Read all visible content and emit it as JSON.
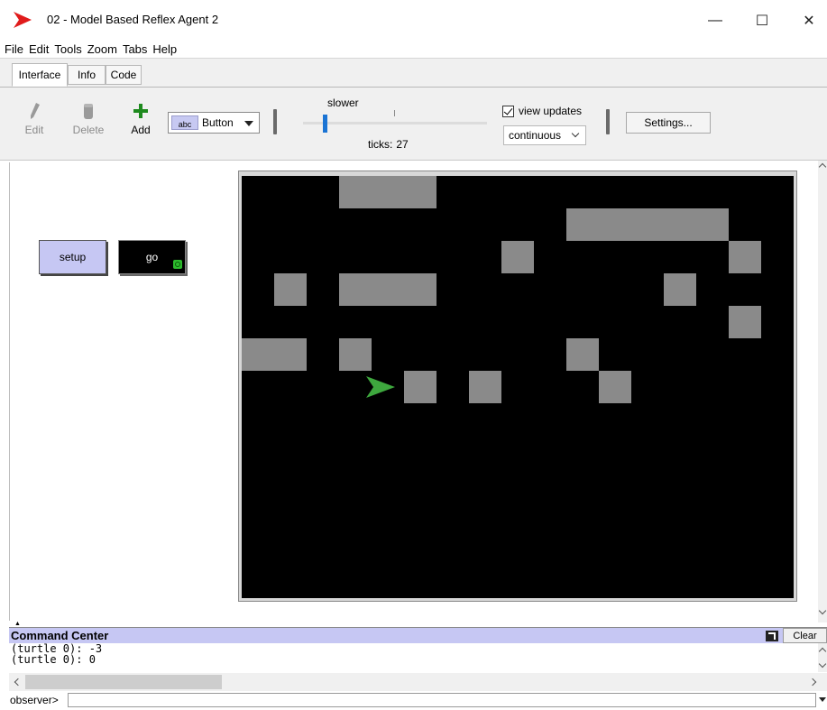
{
  "window": {
    "title": "02 - Model Based Reflex Agent 2",
    "minimize_glyph": "—",
    "maximize_glyph": "☐",
    "close_glyph": "✕"
  },
  "menu": [
    "File",
    "Edit",
    "Tools",
    "Zoom",
    "Tabs",
    "Help"
  ],
  "tabs": [
    {
      "label": "Interface",
      "active": true
    },
    {
      "label": "Info",
      "active": false
    },
    {
      "label": "Code",
      "active": false
    }
  ],
  "toolbar": {
    "edit_label": "Edit",
    "delete_label": "Delete",
    "add_label": "Add",
    "widget_type": "Button",
    "widget_icon_text": "abc",
    "speed_label": "slower",
    "ticks_label": "ticks:",
    "ticks_value": "27",
    "view_updates_label": "view updates",
    "view_updates_checked": true,
    "update_mode": "continuous",
    "settings_label": "Settings..."
  },
  "widgets": {
    "setup_label": "setup",
    "go_label": "go"
  },
  "world": {
    "background": "#000000",
    "patch_color": "#8a8a8a",
    "turtle_color": "#3ea83e",
    "columns": 17,
    "rows": 13,
    "gray_patches": [
      [
        3,
        0
      ],
      [
        4,
        0
      ],
      [
        5,
        0
      ],
      [
        10,
        1
      ],
      [
        11,
        1
      ],
      [
        12,
        1
      ],
      [
        13,
        1
      ],
      [
        14,
        1
      ],
      [
        8,
        2
      ],
      [
        15,
        2
      ],
      [
        1,
        3
      ],
      [
        3,
        3
      ],
      [
        4,
        3
      ],
      [
        5,
        3
      ],
      [
        13,
        3
      ],
      [
        15,
        4
      ],
      [
        0,
        5
      ],
      [
        1,
        5
      ],
      [
        3,
        5
      ],
      [
        10,
        5
      ],
      [
        5,
        6
      ],
      [
        7,
        6
      ],
      [
        11,
        6
      ]
    ],
    "turtle_cell": [
      4,
      6
    ]
  },
  "command_center": {
    "title": "Command Center",
    "clear_label": "Clear",
    "output_lines": [
      "(turtle 0): -3",
      "(turtle 0): 0"
    ],
    "prompt": "observer>",
    "input_value": ""
  },
  "colors": {
    "button_purple": "#c6c7f3",
    "speed_thumb": "#1b74d4",
    "app_logo": "#e01b1b",
    "add_icon": "#1e8a1e"
  }
}
